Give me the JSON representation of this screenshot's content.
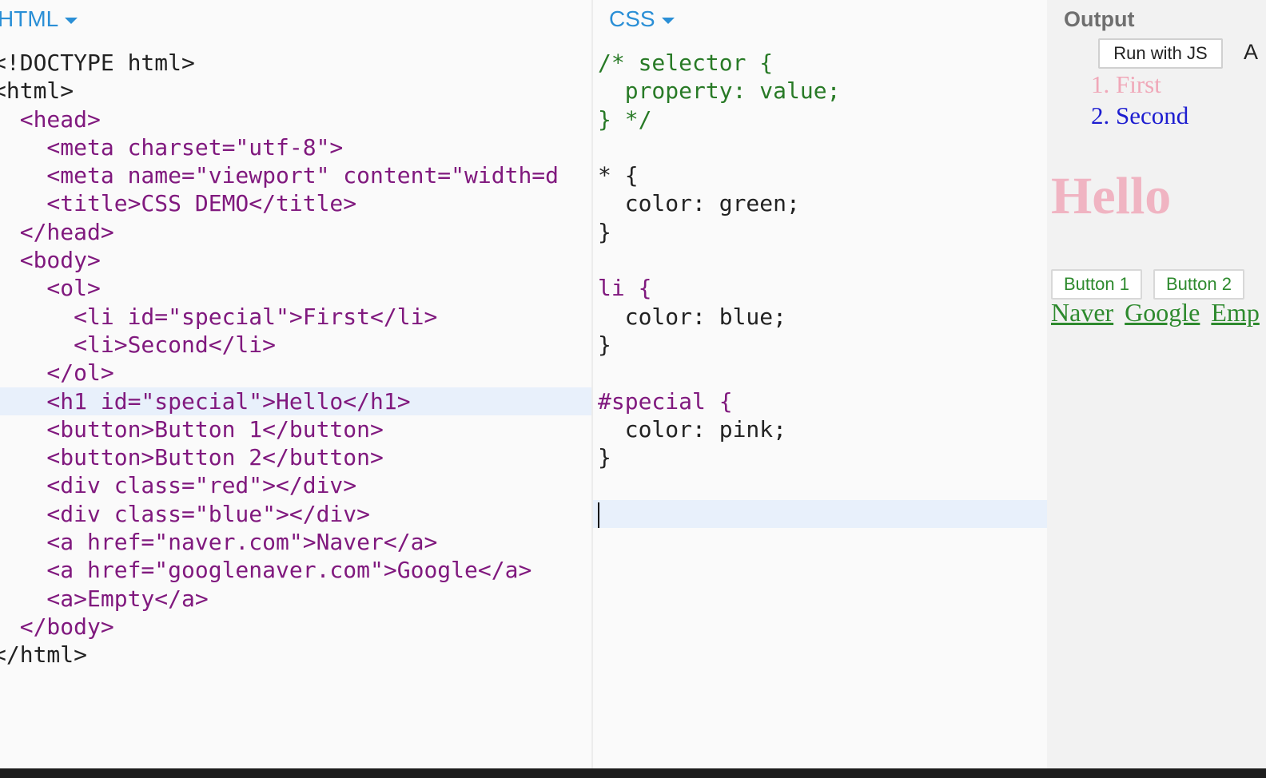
{
  "html_panel": {
    "title": "HTML",
    "lines": [
      "<!DOCTYPE html>",
      "<html>",
      "  <head>",
      "    <meta charset=\"utf-8\">",
      "    <meta name=\"viewport\" content=\"width=d",
      "    <title>CSS DEMO</title>",
      "  </head>",
      "  <body>",
      "    <ol>",
      "      <li id=\"special\">First</li>",
      "      <li>Second</li>",
      "    </ol>",
      "    <h1 id=\"special\">Hello</h1>",
      "    <button>Button 1</button>",
      "    <button>Button 2</button>",
      "    <div class=\"red\"></div>",
      "    <div class=\"blue\"></div>",
      "    <a href=\"naver.com\">Naver</a>",
      "    <a href=\"googlenaver.com\">Google</a>",
      "    <a>Empty</a>",
      "  </body>",
      "</html>"
    ],
    "active_line": 13
  },
  "css_panel": {
    "title": "CSS",
    "lines": [
      "/* selector {",
      "  property: value;",
      "} */",
      "",
      "* {",
      "  color: green;",
      "}",
      "",
      "li {",
      "  color: blue;",
      "}",
      "",
      "#special {",
      "  color: pink;",
      "}",
      "",
      ""
    ],
    "active_line": 17
  },
  "output_panel": {
    "title": "Output",
    "run_button": "Run with JS",
    "trailing_text": "A",
    "list_items": [
      "1. First",
      "2. Second"
    ],
    "heading": "Hello",
    "buttons": [
      "Button 1",
      "Button 2"
    ],
    "links": [
      "Naver",
      "Google",
      "Emp"
    ]
  },
  "colors": {
    "panel_title": "#2a8fd6",
    "pink_rendered": "#f0a7b8",
    "blue_rendered": "#1d1dd0",
    "green_rendered": "#2e8a2e",
    "active_line": "#e8f0fb"
  }
}
